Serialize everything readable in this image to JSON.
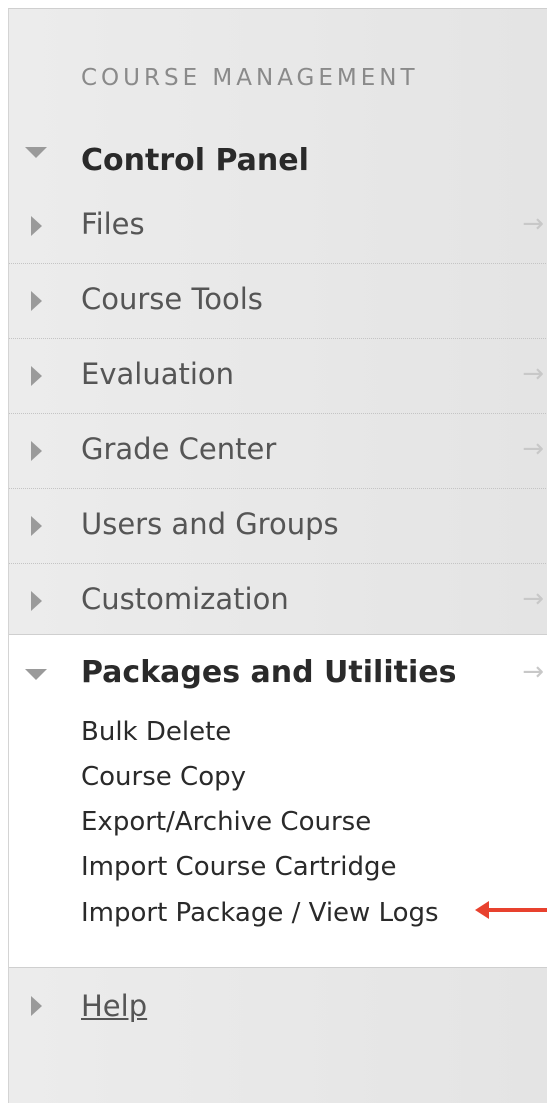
{
  "section_heading": "COURSE MANAGEMENT",
  "control_panel": {
    "title": "Control Panel",
    "items": [
      {
        "label": "Files",
        "arrow": "→"
      },
      {
        "label": "Course Tools",
        "arrow": ""
      },
      {
        "label": "Evaluation",
        "arrow": "→"
      },
      {
        "label": "Grade Center",
        "arrow": "→"
      },
      {
        "label": "Users and Groups",
        "arrow": ""
      },
      {
        "label": "Customization",
        "arrow": "→"
      }
    ]
  },
  "packages": {
    "title": "Packages and Utilities",
    "arrow": "→",
    "links": [
      "Bulk Delete",
      "Course Copy",
      "Export/Archive Course",
      "Import Course Cartridge",
      "Import Package / View Logs"
    ]
  },
  "help": {
    "label": "Help"
  },
  "colors": {
    "annotation_arrow": "#e8412e"
  }
}
